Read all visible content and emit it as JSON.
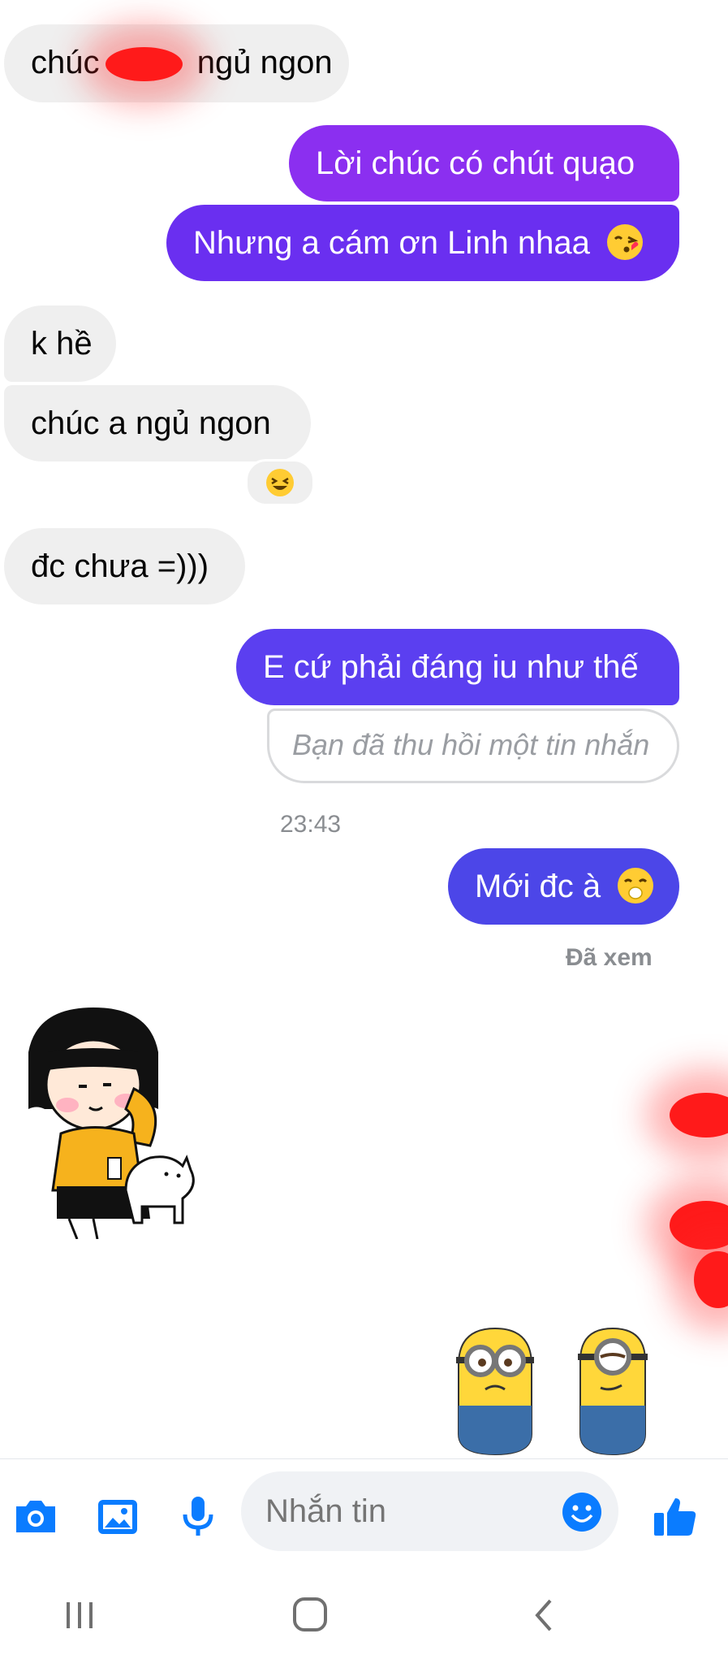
{
  "messages": [
    {
      "id": "m1",
      "side": "in",
      "text": "chúc ngủ ngon",
      "part_a": "chúc",
      "part_b": "ngủ ngon"
    },
    {
      "id": "m2",
      "side": "out",
      "text": "Lời chúc có chút quạo"
    },
    {
      "id": "m3",
      "side": "out",
      "text": "Nhưng a cám ơn Linh nhaa"
    },
    {
      "id": "m4",
      "side": "in",
      "text": "k hề"
    },
    {
      "id": "m5",
      "side": "in",
      "text": "chúc a ngủ ngon"
    },
    {
      "id": "m6",
      "side": "in",
      "text": "đc chưa =)))"
    },
    {
      "id": "m7",
      "side": "out",
      "text": "E cứ phải đáng iu như thế"
    },
    {
      "id": "m8",
      "side": "out",
      "text": "Bạn đã thu hồi một tin nhắn",
      "status": "unsent"
    },
    {
      "id": "m9",
      "side": "out",
      "text": "Mới đc à"
    }
  ],
  "timestamp": "23:43",
  "seen_label": "Đã xem",
  "reaction": "laughing-emoji",
  "stickers": [
    {
      "name": "girl-with-cat-sticker",
      "side": "in"
    },
    {
      "name": "minions-sticker",
      "side": "out"
    }
  ],
  "composer": {
    "placeholder": "Nhắn tin",
    "icons": [
      "camera-icon",
      "image-icon",
      "microphone-icon",
      "emoji-icon",
      "like-icon"
    ]
  },
  "navbar": {
    "icons": [
      "recents-icon",
      "home-icon",
      "back-icon"
    ]
  },
  "colors": {
    "incoming_bubble": "#efefef",
    "outgoing_purple": "#8b2ff0",
    "outgoing_violet": "#6a2ff0",
    "outgoing_indigo": "#5b3ff0",
    "outgoing_blue": "#4c46e8",
    "accent_blue": "#0a7cff",
    "redaction": "#ff1a1a"
  }
}
